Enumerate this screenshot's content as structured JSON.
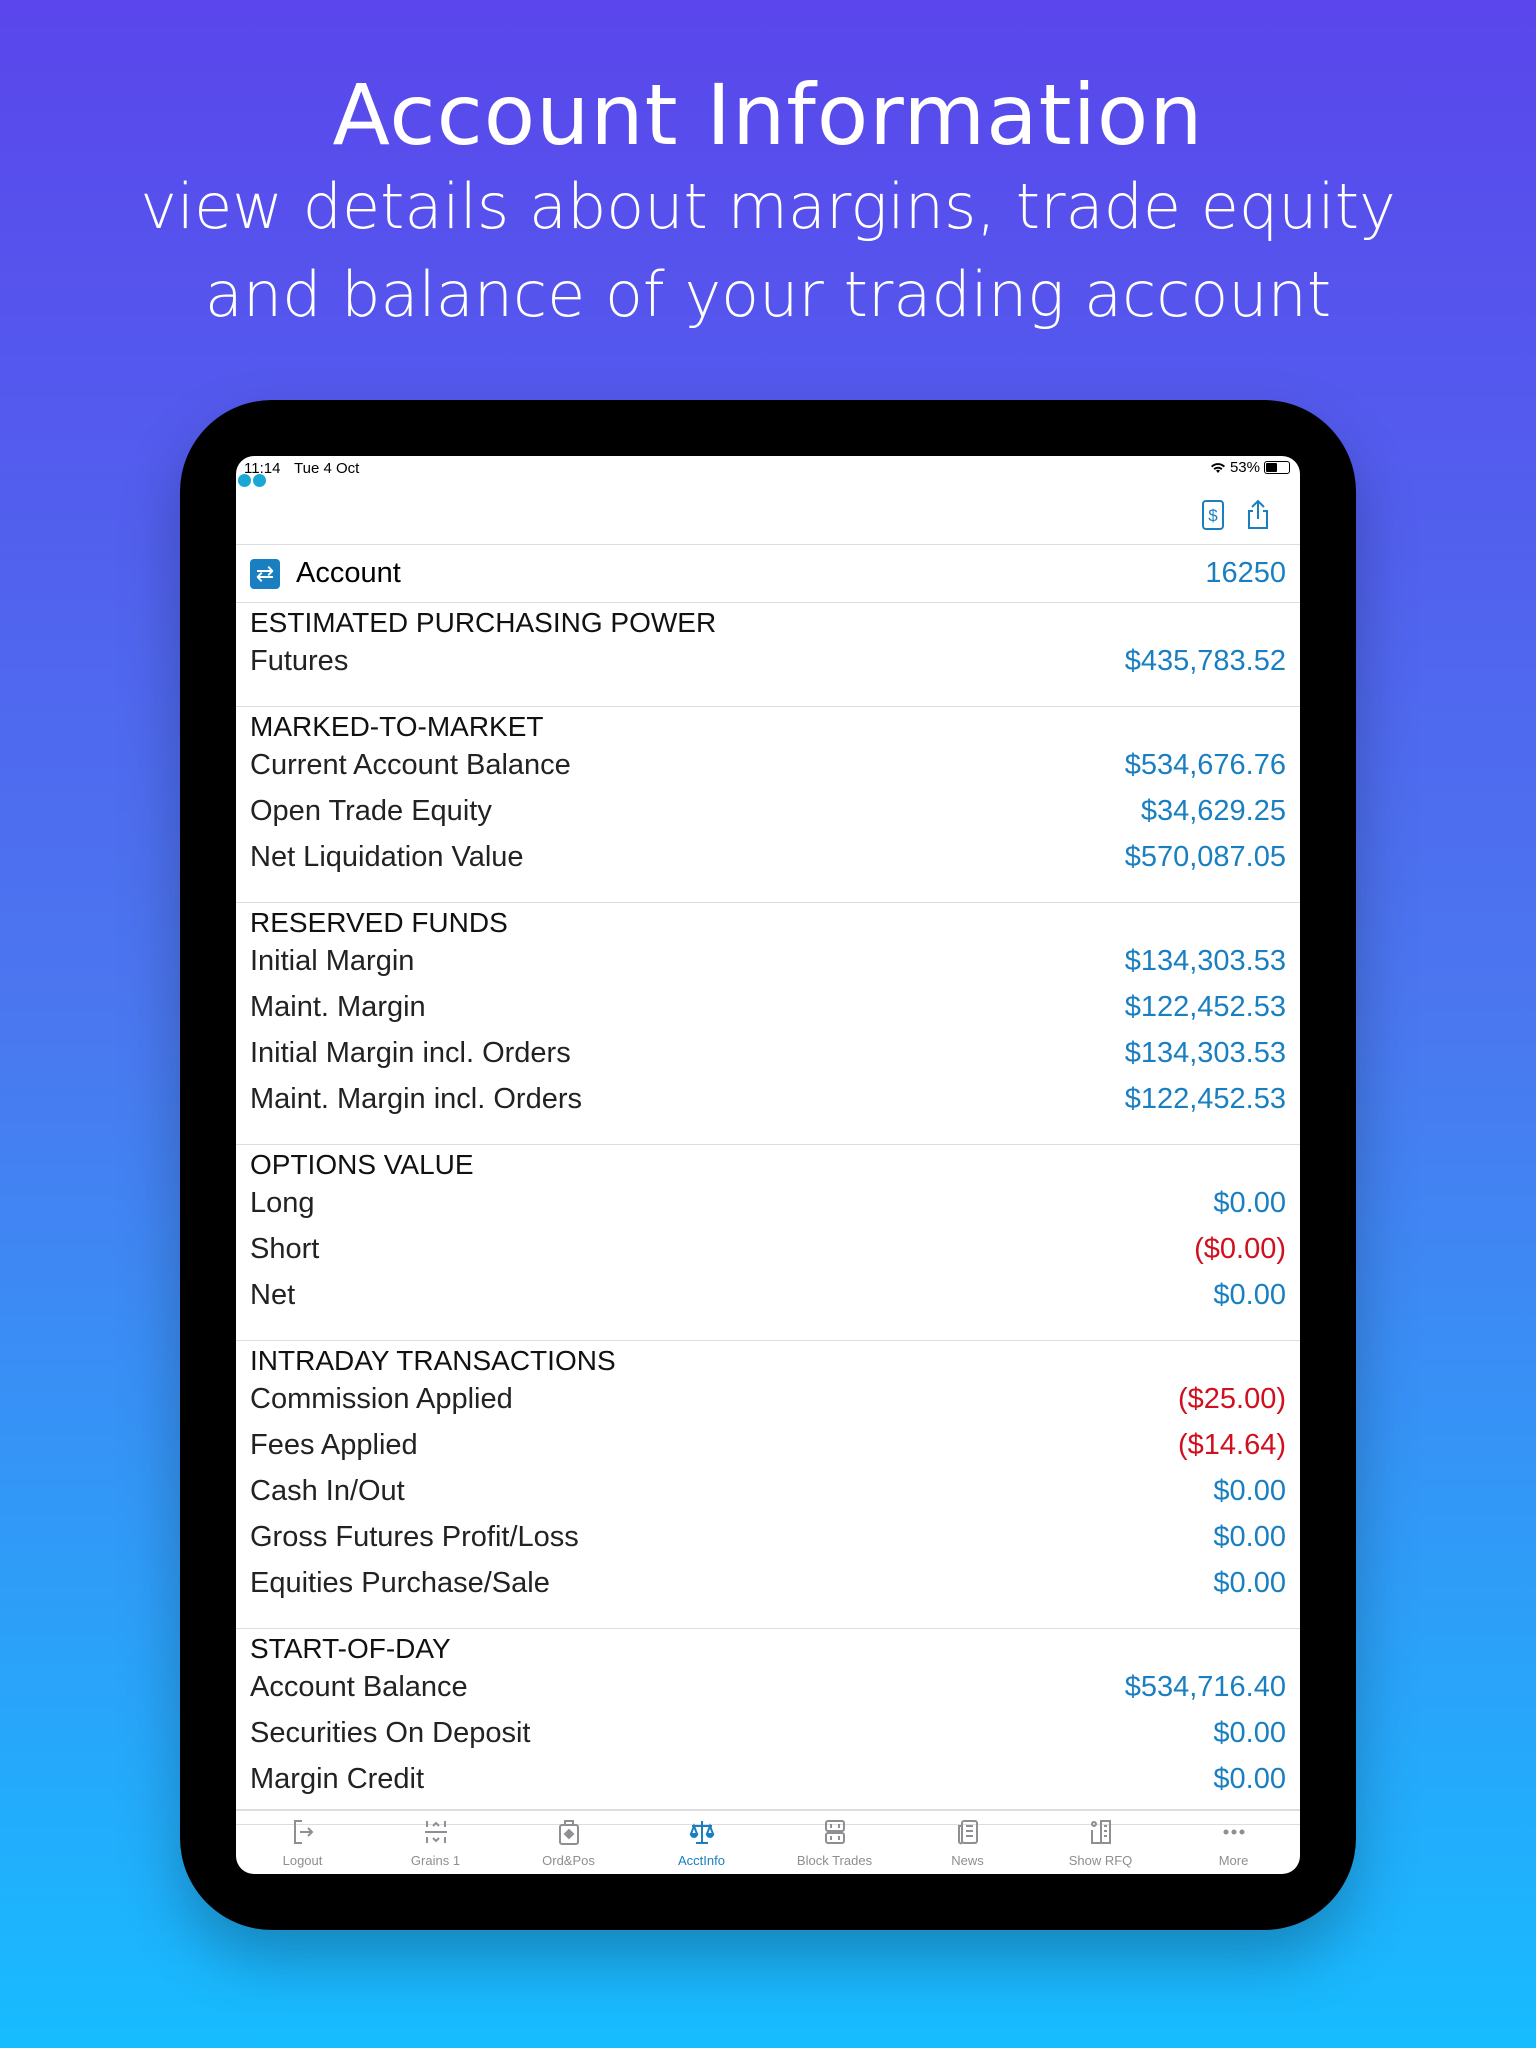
{
  "hero": {
    "title": "Account Information",
    "subtitle_line1": "view details about margins, trade equity",
    "subtitle_line2": "and balance of your trading account"
  },
  "status": {
    "time": "11:14",
    "date": "Tue 4 Oct",
    "battery": "53%"
  },
  "toolbar": {
    "icons": [
      "currency-exchange-icon",
      "share-icon"
    ]
  },
  "account": {
    "label": "Account",
    "value": "16250"
  },
  "sections": [
    {
      "header": "ESTIMATED PURCHASING POWER",
      "rows": [
        {
          "label": "Futures",
          "value": "$435,783.52",
          "negative": false
        }
      ]
    },
    {
      "header": "MARKED-TO-MARKET",
      "rows": [
        {
          "label": "Current Account Balance",
          "value": "$534,676.76",
          "negative": false
        },
        {
          "label": "Open Trade Equity",
          "value": "$34,629.25",
          "negative": false
        },
        {
          "label": "Net Liquidation Value",
          "value": "$570,087.05",
          "negative": false
        }
      ]
    },
    {
      "header": "RESERVED FUNDS",
      "rows": [
        {
          "label": "Initial Margin",
          "value": "$134,303.53",
          "negative": false
        },
        {
          "label": "Maint. Margin",
          "value": "$122,452.53",
          "negative": false
        },
        {
          "label": "Initial Margin incl. Orders",
          "value": "$134,303.53",
          "negative": false
        },
        {
          "label": "Maint. Margin incl. Orders",
          "value": "$122,452.53",
          "negative": false
        }
      ]
    },
    {
      "header": "OPTIONS VALUE",
      "rows": [
        {
          "label": "Long",
          "value": "$0.00",
          "negative": false
        },
        {
          "label": "Short",
          "value": "($0.00)",
          "negative": true
        },
        {
          "label": "Net",
          "value": "$0.00",
          "negative": false
        }
      ]
    },
    {
      "header": "INTRADAY TRANSACTIONS",
      "rows": [
        {
          "label": "Commission Applied",
          "value": "($25.00)",
          "negative": true
        },
        {
          "label": "Fees Applied",
          "value": "($14.64)",
          "negative": true
        },
        {
          "label": "Cash In/Out",
          "value": "$0.00",
          "negative": false
        },
        {
          "label": "Gross Futures Profit/Loss",
          "value": "$0.00",
          "negative": false
        },
        {
          "label": "Equities Purchase/Sale",
          "value": "$0.00",
          "negative": false
        }
      ]
    },
    {
      "header": "START-OF-DAY",
      "rows": [
        {
          "label": "Account Balance",
          "value": "$534,716.40",
          "negative": false
        },
        {
          "label": "Securities On Deposit",
          "value": "$0.00",
          "negative": false
        },
        {
          "label": "Margin Credit",
          "value": "$0.00",
          "negative": false
        }
      ]
    }
  ],
  "tabs": [
    {
      "label": "Logout",
      "icon": "logout-icon",
      "active": false
    },
    {
      "label": "Grains 1",
      "icon": "grains-icon",
      "active": false
    },
    {
      "label": "Ord&Pos",
      "icon": "orders-positions-icon",
      "active": false
    },
    {
      "label": "AcctInfo",
      "icon": "scales-icon",
      "active": true
    },
    {
      "label": "Block Trades",
      "icon": "block-trades-icon",
      "active": false
    },
    {
      "label": "News",
      "icon": "news-icon",
      "active": false
    },
    {
      "label": "Show RFQ",
      "icon": "rfq-icon",
      "active": false
    },
    {
      "label": "More",
      "icon": "more-icon",
      "active": false
    }
  ],
  "colors": {
    "accent": "#1a7fc1",
    "negative": "#d0101e"
  }
}
